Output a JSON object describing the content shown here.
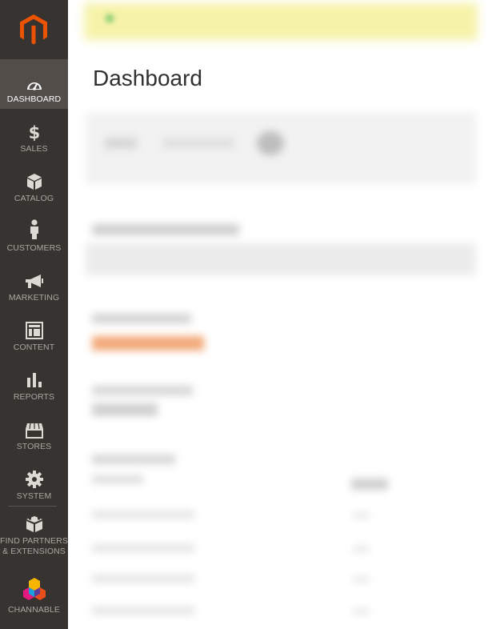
{
  "page": {
    "title": "Dashboard"
  },
  "colors": {
    "sidebar_bg": "#373330",
    "sidebar_active": "#524d49",
    "brand_orange": "#eb5202",
    "notice_bg": "#f6f3a8"
  },
  "sidebar": {
    "items": [
      {
        "label": "DASHBOARD",
        "icon": "speedometer-icon",
        "active": true
      },
      {
        "label": "SALES",
        "icon": "dollar-icon"
      },
      {
        "label": "CATALOG",
        "icon": "box-icon"
      },
      {
        "label": "CUSTOMERS",
        "icon": "person-icon"
      },
      {
        "label": "MARKETING",
        "icon": "megaphone-icon"
      },
      {
        "label": "CONTENT",
        "icon": "layout-icon"
      },
      {
        "label": "REPORTS",
        "icon": "bar-chart-icon"
      },
      {
        "label": "STORES",
        "icon": "storefront-icon"
      },
      {
        "label": "SYSTEM",
        "icon": "gear-icon"
      },
      {
        "label": "FIND PARTNERS & EXTENSIONS",
        "icon": "blocks-icon"
      },
      {
        "label": "CHANNABLE",
        "icon": "channable-logo-icon"
      }
    ]
  }
}
